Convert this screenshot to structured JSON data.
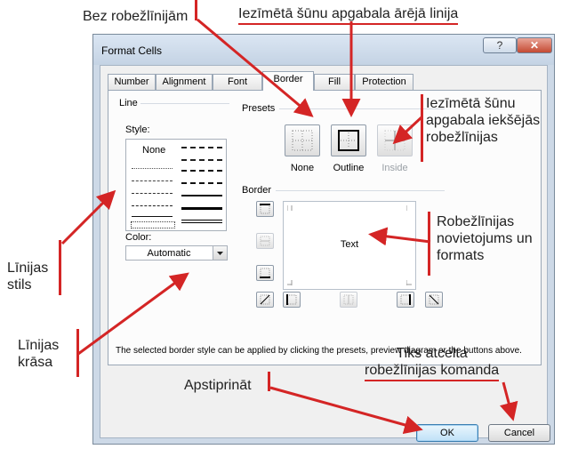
{
  "dialog": {
    "title": "Format Cells",
    "help_label": "?",
    "close_label": "✕",
    "tabs": [
      {
        "label": "Number"
      },
      {
        "label": "Alignment"
      },
      {
        "label": "Font"
      },
      {
        "label": "Border",
        "active": true
      },
      {
        "label": "Fill"
      },
      {
        "label": "Protection"
      }
    ],
    "line_section": {
      "title": "Line",
      "style_label": "Style:",
      "none_label": "None",
      "color_label": "Color:",
      "color_value": "Automatic"
    },
    "presets_section": {
      "title": "Presets",
      "none_label": "None",
      "outline_label": "Outline",
      "inside_label": "Inside"
    },
    "border_section": {
      "title": "Border",
      "preview_text": "Text"
    },
    "hint_text": "The selected border style can be applied by clicking the presets, preview diagram or the buttons above.",
    "ok_label": "OK",
    "cancel_label": "Cancel"
  },
  "annotations": {
    "no_borders": "Bez robežlīnijām",
    "outline": "Iezīmētā šūnu apgabala ārējā linija",
    "inside_line1": "Iezīmētā šūnu",
    "inside_line2": "apgabala iekšējās",
    "inside_line3": "robežlīnijas",
    "position_line1": "Robežlīnijas",
    "position_line2": "novietojums un",
    "position_line3": "formats",
    "style_line1": "Līnijas",
    "style_line2": "stils",
    "color_line1": "Līnijas",
    "color_line2": "krāsa",
    "confirm": "Apstiprināt",
    "cancel_line1": "Tiks atcelta",
    "cancel_line2": "robežlīnijas komanda"
  },
  "colors": {
    "annotation_red": "#d42525",
    "dialog_frame": "#cdd9e7",
    "close_button": "#c44a32",
    "ok_button_highlight": "#bfe1f7"
  }
}
